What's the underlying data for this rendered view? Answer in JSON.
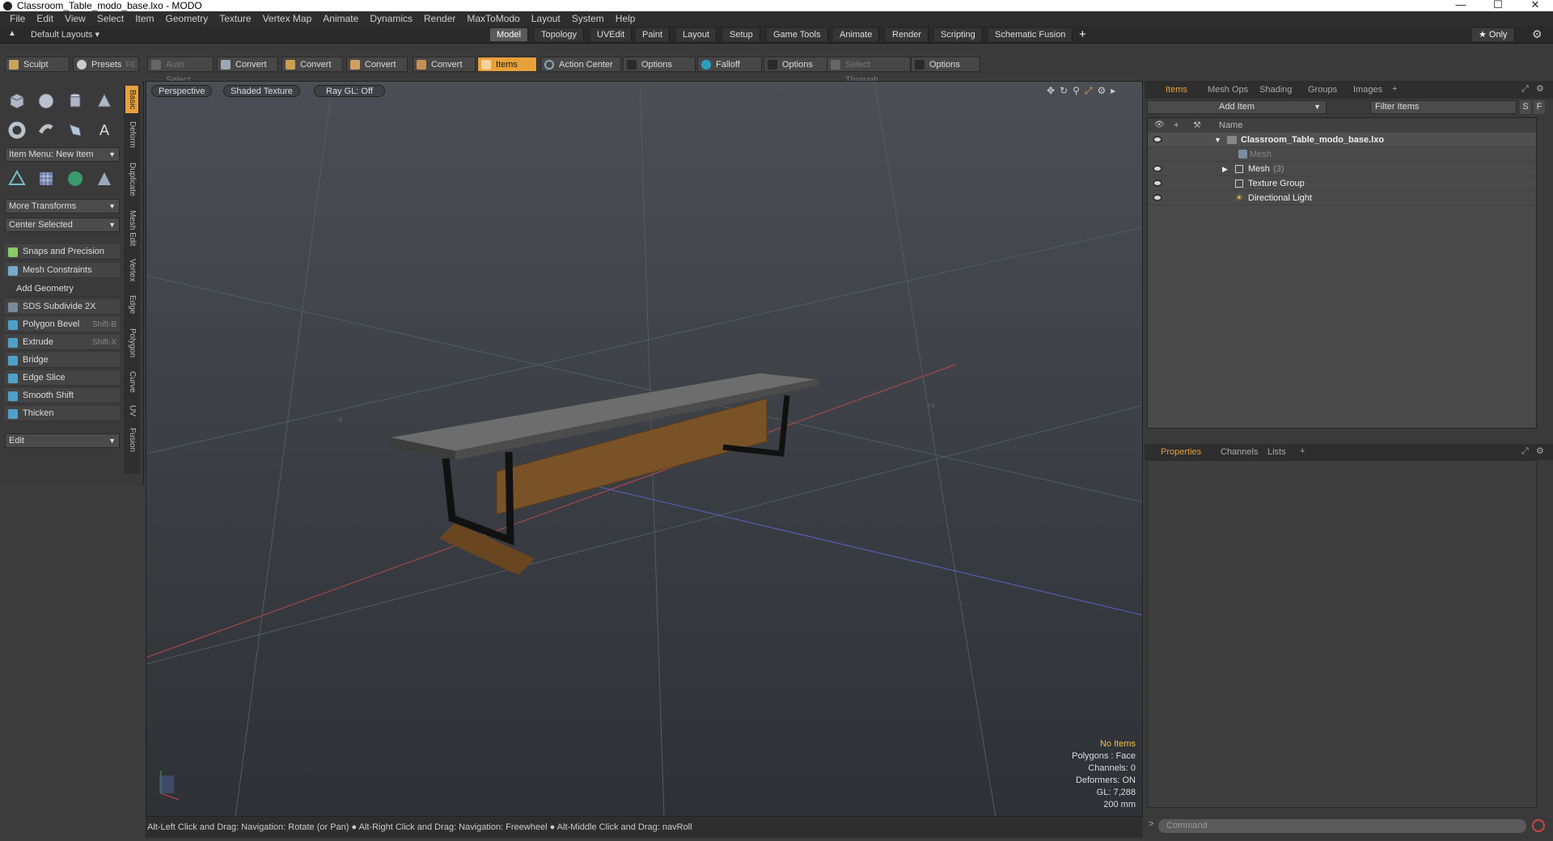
{
  "window": {
    "title": "Classroom_Table_modo_base.lxo - MODO",
    "controls": [
      "—",
      "☐",
      "✕"
    ]
  },
  "menubar": [
    "File",
    "Edit",
    "View",
    "Select",
    "Item",
    "Geometry",
    "Texture",
    "Vertex Map",
    "Animate",
    "Dynamics",
    "Render",
    "MaxToModo",
    "Layout",
    "System",
    "Help"
  ],
  "layoutbar": {
    "layouts": "Default Layouts ▾",
    "tabs": [
      "Model",
      "Topology",
      "UVEdit",
      "Paint",
      "Layout",
      "Setup",
      "Game Tools",
      "Animate",
      "Render",
      "Scripting",
      "Schematic Fusion"
    ],
    "active_tab": "Model",
    "plus": "+",
    "only": "★ Only",
    "gear": "⚙"
  },
  "toolbar": {
    "sculpt": "Sculpt",
    "presets": "Presets",
    "presets_key": "F6",
    "auto_select": "Auto Select",
    "convert": "Convert",
    "items": "Items",
    "action_center": "Action Center",
    "options": "Options",
    "falloff": "Falloff",
    "select_through": "Select Through"
  },
  "left": {
    "vtabs": [
      "Basic",
      "Deform",
      "Duplicate",
      "Mesh Edit",
      "Vertex",
      "Edge",
      "Polygon",
      "Curve",
      "UV",
      "Fusion"
    ],
    "item_menu": "Item Menu: New Item",
    "more_transforms": "More Transforms",
    "center_selected": "Center Selected",
    "snaps": "Snaps and Precision",
    "mesh_constraints": "Mesh Constraints",
    "add_geometry": "Add Geometry",
    "tools": [
      {
        "label": "SDS Subdivide 2X",
        "key": "",
        "color": "#7a8a9a"
      },
      {
        "label": "Polygon Bevel",
        "key": "Shift-B",
        "color": "#4fa0c8"
      },
      {
        "label": "Extrude",
        "key": "Shift-X",
        "color": "#4fa0c8"
      },
      {
        "label": "Bridge",
        "key": "",
        "color": "#4fa0c8"
      },
      {
        "label": "Edge Slice",
        "key": "",
        "color": "#4fa0c8"
      },
      {
        "label": "Smooth Shift",
        "key": "",
        "color": "#4fa0c8"
      },
      {
        "label": "Thicken",
        "key": "",
        "color": "#4fa0c8"
      }
    ],
    "edit": "Edit"
  },
  "viewport": {
    "perspective": "Perspective",
    "shading": "Shaded Texture",
    "raygl": "Ray GL: Off",
    "stats": {
      "no_items": "No Items",
      "polygons": "Polygons : Face",
      "channels": "Channels: 0",
      "deformers": "Deformers: ON",
      "gl": "GL: 7,288",
      "scale": "200 mm"
    }
  },
  "statusbar": "Alt-Left Click and Drag: Navigation: Rotate (or Pan) ●  Alt-Right Click and Drag: Navigation: Freewheel ●  Alt-Middle Click and Drag: navRoll",
  "items_panel": {
    "tabs": [
      "Items",
      "Mesh Ops",
      "Shading",
      "Groups",
      "Images"
    ],
    "active_tab": "Items",
    "add_item": "Add Item",
    "filter": "Filter Items",
    "sf": [
      "S",
      "F"
    ],
    "name_header": "Name",
    "rows": [
      {
        "label": "Classroom_Table_modo_base.lxo",
        "indent": 0,
        "bold": true
      },
      {
        "label": "Mesh",
        "indent": 1,
        "dim": true
      },
      {
        "label": "Mesh",
        "suffix": "(3)",
        "indent": 1
      },
      {
        "label": "Texture Group",
        "indent": 1
      },
      {
        "label": "Directional Light",
        "indent": 1
      }
    ]
  },
  "props_panel": {
    "tabs": [
      "Properties",
      "Channels",
      "Lists"
    ],
    "active_tab": "Properties",
    "plus": "+"
  },
  "command": {
    "placeholder": "Command",
    "prompt": ">"
  }
}
